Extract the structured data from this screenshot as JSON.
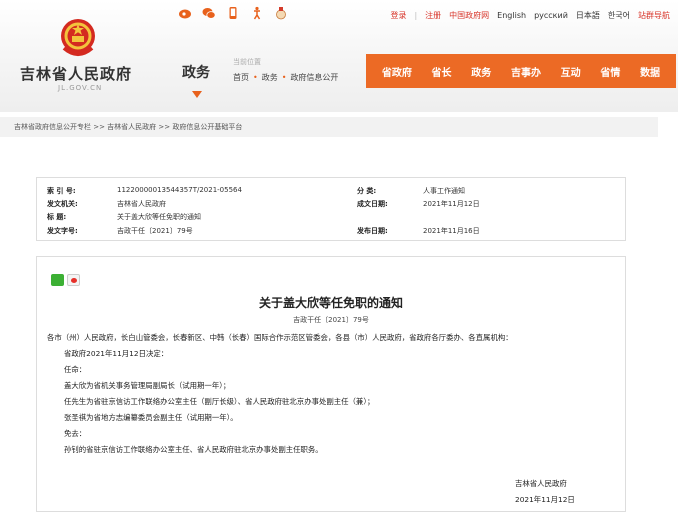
{
  "top": {
    "links": [
      "登录",
      "注册",
      "中国政府网",
      "English",
      "русский",
      "日本語",
      "한국어",
      "站群导航"
    ],
    "social_icons": [
      "weibo-icon",
      "weixin-icon",
      "mobile-icon",
      "accessibility-icon",
      "mascot-icon"
    ]
  },
  "site": {
    "title": "吉林省人民政府",
    "domain": "JL.GOV.CN",
    "section": "政务"
  },
  "location": {
    "label": "当前位置",
    "path": [
      "首页",
      "政务",
      "政府信息公开"
    ]
  },
  "mainnav": [
    "省政府",
    "省长",
    "政务",
    "吉事办",
    "互动",
    "省情",
    "数据"
  ],
  "breadcrumb": "吉林省政府信息公开专栏 >> 吉林省人民政府 >> 政府信息公开基础平台",
  "meta": {
    "index_label": "索 引 号:",
    "index_value": "11220000013544357T/2021-05564",
    "category_label": "分 类:",
    "category_value": "人事工作通知",
    "issuer_label": "发文机关:",
    "issuer_value": "吉林省人民政府",
    "date_label": "成文日期:",
    "date_value": "2021年11月12日",
    "title_label": "标 题:",
    "title_value": "关于盖大欣等任免职的通知",
    "doc_label": "发文字号:",
    "doc_value": "吉政干任〔2021〕79号",
    "pub_label": "发布日期:",
    "pub_value": "2021年11月16日"
  },
  "article": {
    "title": "关于盖大欣等任免职的通知",
    "doc_number": "吉政干任〔2021〕79号",
    "paragraphs": [
      "各市（州）人民政府，长白山管委会，长春新区、中韩（长春）国际合作示范区管委会，各县（市）人民政府，省政府各厅委办、各直属机构：",
      "省政府2021年11月12日决定：",
      "任命：",
      "盖大欣为省机关事务管理局副局长（试用期一年）；",
      "任先生为省驻京信访工作联络办公室主任（副厅长级）、省人民政府驻北京办事处副主任（兼）；",
      "张圣祺为省地方志编纂委员会副主任（试用期一年）。",
      "免去：",
      "孙钊的省驻京信访工作联络办公室主任、省人民政府驻北京办事处副主任职务。"
    ],
    "sign_org": "吉林省人民政府",
    "sign_date": "2021年11月12日"
  }
}
